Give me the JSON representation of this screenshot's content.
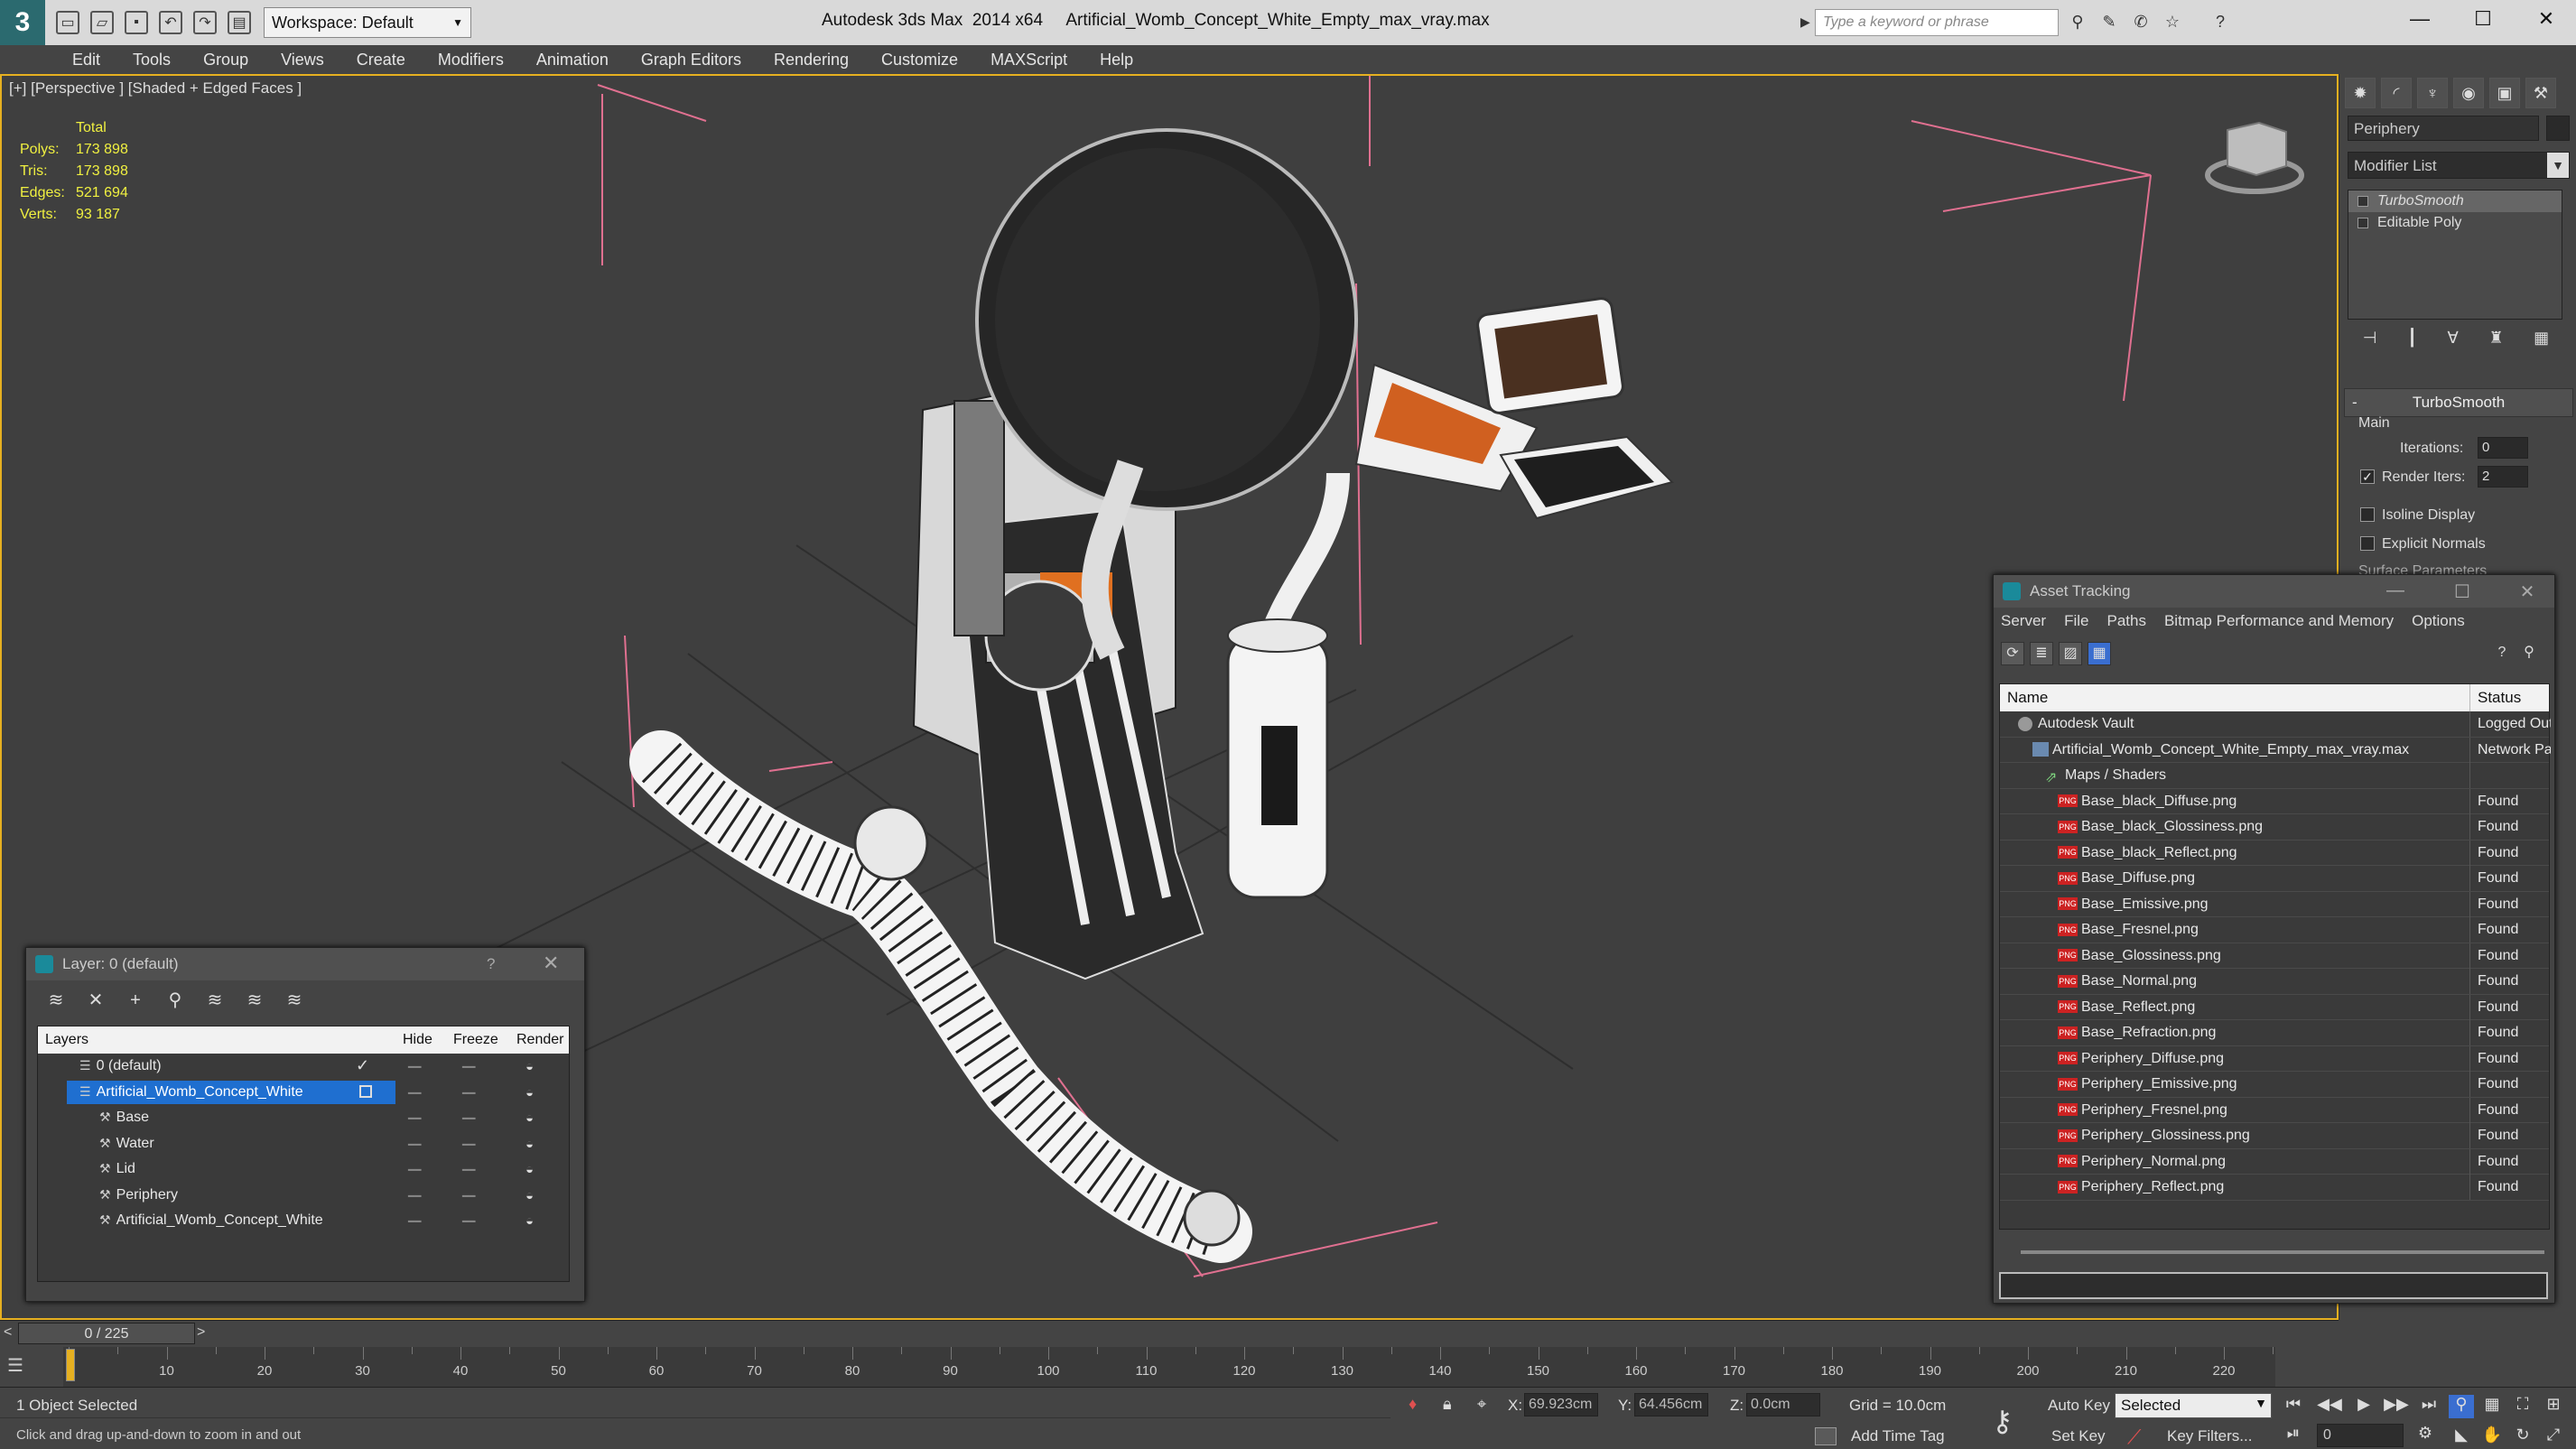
{
  "app": {
    "title": "Autodesk 3ds Max  2014 x64     Artificial_Womb_Concept_White_Empty_max_vray.max",
    "workspace": "Workspace: Default",
    "search_placeholder": "Type a keyword or phrase"
  },
  "menu": [
    "Edit",
    "Tools",
    "Group",
    "Views",
    "Create",
    "Modifiers",
    "Animation",
    "Graph Editors",
    "Rendering",
    "Customize",
    "MAXScript",
    "Help"
  ],
  "viewport": {
    "label": "[+] [Perspective ] [Shaded + Edged Faces ]",
    "stats": {
      "total_label": "Total",
      "rows": [
        {
          "k": "Polys:",
          "v": "173 898"
        },
        {
          "k": "Tris:",
          "v": "173 898"
        },
        {
          "k": "Edges:",
          "v": "521 694"
        },
        {
          "k": "Verts:",
          "v": "93 187"
        }
      ]
    }
  },
  "command_panel": {
    "object_name": "Periphery",
    "modifier_list": "Modifier List",
    "stack": [
      "TurboSmooth",
      "Editable Poly"
    ],
    "rollout": "TurboSmooth",
    "main_label": "Main",
    "iterations_label": "Iterations:",
    "iterations_value": "0",
    "render_iters_label": "Render Iters:",
    "render_iters_value": "2",
    "isoline_label": "Isoline Display",
    "explicit_normals_label": "Explicit Normals",
    "surface_params_label": "Surface Parameters"
  },
  "asset_tracking": {
    "title": "Asset Tracking",
    "menu": [
      "Server",
      "File",
      "Paths",
      "Bitmap Performance and Memory",
      "Options"
    ],
    "col_name": "Name",
    "col_status": "Status",
    "rows": [
      {
        "name": "Autodesk Vault",
        "status": "Logged Out",
        "kind": "vault",
        "indent": 20
      },
      {
        "name": "Artificial_Womb_Concept_White_Empty_max_vray.max",
        "status": "Network Path",
        "kind": "max",
        "indent": 36
      },
      {
        "name": "Maps / Shaders",
        "status": "",
        "kind": "folder",
        "indent": 50
      },
      {
        "name": "Base_black_Diffuse.png",
        "status": "Found",
        "kind": "png",
        "indent": 64
      },
      {
        "name": "Base_black_Glossiness.png",
        "status": "Found",
        "kind": "png",
        "indent": 64
      },
      {
        "name": "Base_black_Reflect.png",
        "status": "Found",
        "kind": "png",
        "indent": 64
      },
      {
        "name": "Base_Diffuse.png",
        "status": "Found",
        "kind": "png",
        "indent": 64
      },
      {
        "name": "Base_Emissive.png",
        "status": "Found",
        "kind": "png",
        "indent": 64
      },
      {
        "name": "Base_Fresnel.png",
        "status": "Found",
        "kind": "png",
        "indent": 64
      },
      {
        "name": "Base_Glossiness.png",
        "status": "Found",
        "kind": "png",
        "indent": 64
      },
      {
        "name": "Base_Normal.png",
        "status": "Found",
        "kind": "png",
        "indent": 64
      },
      {
        "name": "Base_Reflect.png",
        "status": "Found",
        "kind": "png",
        "indent": 64
      },
      {
        "name": "Base_Refraction.png",
        "status": "Found",
        "kind": "png",
        "indent": 64
      },
      {
        "name": "Periphery_Diffuse.png",
        "status": "Found",
        "kind": "png",
        "indent": 64
      },
      {
        "name": "Periphery_Emissive.png",
        "status": "Found",
        "kind": "png",
        "indent": 64
      },
      {
        "name": "Periphery_Fresnel.png",
        "status": "Found",
        "kind": "png",
        "indent": 64
      },
      {
        "name": "Periphery_Glossiness.png",
        "status": "Found",
        "kind": "png",
        "indent": 64
      },
      {
        "name": "Periphery_Normal.png",
        "status": "Found",
        "kind": "png",
        "indent": 64
      },
      {
        "name": "Periphery_Reflect.png",
        "status": "Found",
        "kind": "png",
        "indent": 64
      }
    ]
  },
  "layer_dialog": {
    "title": "Layer: 0 (default)",
    "help": "?",
    "col_layers": "Layers",
    "col_hide": "Hide",
    "col_freeze": "Freeze",
    "col_render": "Render",
    "rows": [
      {
        "name": "0 (default)",
        "selected": false,
        "indent": 0,
        "check": true
      },
      {
        "name": "Artificial_Womb_Concept_White",
        "selected": true,
        "indent": 0,
        "current": true
      },
      {
        "name": "Base",
        "selected": false,
        "indent": 22
      },
      {
        "name": "Water",
        "selected": false,
        "indent": 22
      },
      {
        "name": "Lid",
        "selected": false,
        "indent": 22
      },
      {
        "name": "Periphery",
        "selected": false,
        "indent": 22
      },
      {
        "name": "Artificial_Womb_Concept_White",
        "selected": false,
        "indent": 22
      }
    ]
  },
  "timeline": {
    "slider": "0 / 225",
    "ticks": [
      10,
      20,
      30,
      40,
      50,
      60,
      70,
      80,
      90,
      100,
      110,
      120,
      130,
      140,
      150,
      160,
      170,
      180,
      190,
      200,
      210,
      220
    ]
  },
  "status": {
    "selection": "1 Object Selected",
    "prompt": "Click and drag up-and-down to zoom in and out",
    "x_label": "X:",
    "x_value": "69.923cm",
    "y_label": "Y:",
    "y_value": "64.456cm",
    "z_label": "Z:",
    "z_value": "0.0cm",
    "grid": "Grid = 10.0cm",
    "add_time_tag": "Add Time Tag",
    "auto_key": "Auto Key",
    "set_key": "Set Key",
    "selected_option": "Selected",
    "key_filters": "Key Filters...",
    "frame": "0"
  }
}
